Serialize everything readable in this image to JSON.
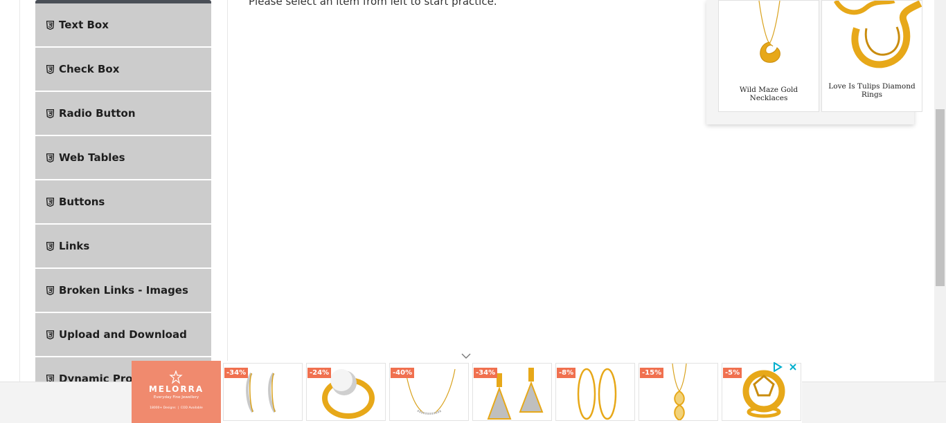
{
  "main": {
    "practice_text": "Please select an item from left to start practice."
  },
  "sidebar": {
    "icon_name": "html5-icon",
    "items": [
      {
        "label": "Text Box"
      },
      {
        "label": "Check Box"
      },
      {
        "label": "Radio Button"
      },
      {
        "label": "Web Tables"
      },
      {
        "label": "Buttons"
      },
      {
        "label": "Links"
      },
      {
        "label": "Broken Links - Images"
      },
      {
        "label": "Upload and Download"
      },
      {
        "label": "Dynamic Properties"
      }
    ]
  },
  "ad_top": {
    "products": [
      {
        "caption": "Wild Maze Gold Necklaces"
      },
      {
        "caption": "Love Is Tulips Diamond Rings"
      }
    ]
  },
  "ad_bottom": {
    "brand": {
      "name": "MELORRA",
      "tagline": "Everyday Fine Jewellery",
      "stat1_value": "18000+",
      "stat1_label": "Designs",
      "stat2_value": "COD",
      "stat2_label": "Available"
    },
    "discounts": [
      "-34%",
      "-24%",
      "-40%",
      "-34%",
      "-8%",
      "-15%",
      "-5%"
    ],
    "icons": {
      "adchoices": "adchoices-icon",
      "close": "close-icon",
      "collapse": "chevron-down-icon"
    }
  },
  "colors": {
    "sidebar_item_bg": "#cccccc",
    "sidebar_cap": "#4a4f57",
    "brand_tile": "#f08a6e",
    "discount_badge": "#f0704f",
    "gold": "#e8a317"
  }
}
